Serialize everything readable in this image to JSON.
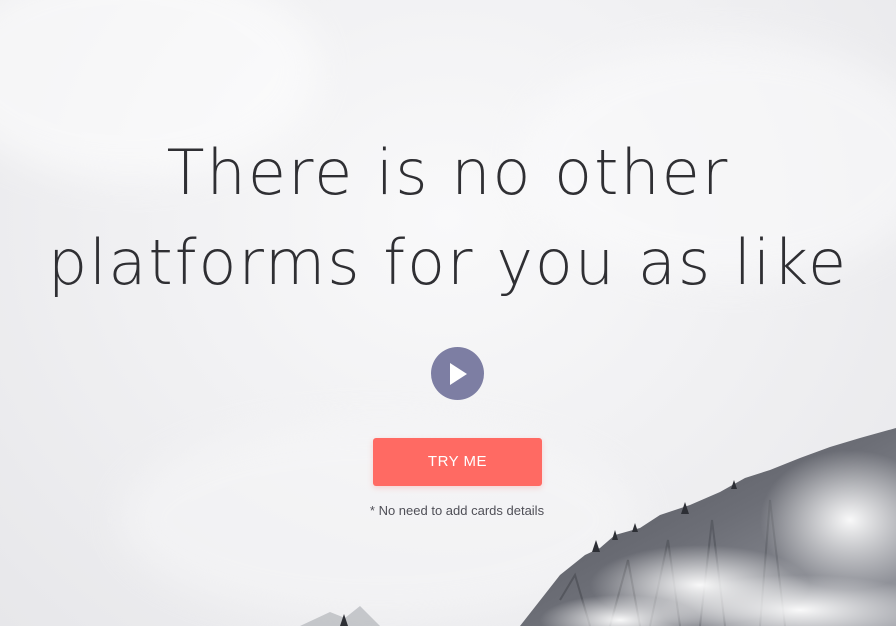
{
  "hero": {
    "headline_line1": "There is no other",
    "headline_line2": "platforms for you as like"
  },
  "play": {
    "icon": "play-icon",
    "color": "#7d7ea3"
  },
  "cta": {
    "label": "TRY ME",
    "color": "#ff6a63"
  },
  "note": {
    "text": "* No need to add cards details"
  }
}
